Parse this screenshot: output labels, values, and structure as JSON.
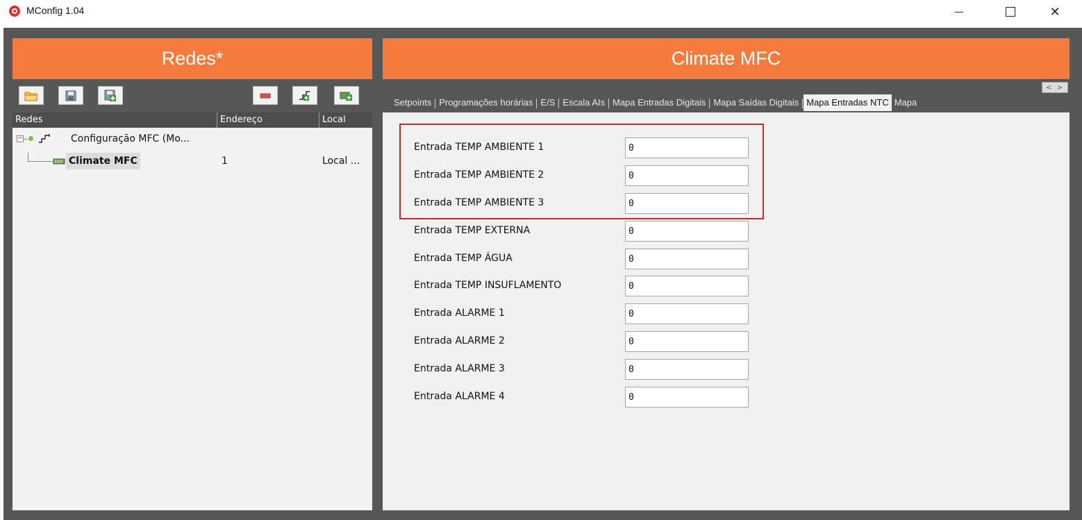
{
  "window": {
    "title": "MConfig 1.04"
  },
  "left": {
    "header": "Redes*",
    "toolbar": [
      "open-folder-icon",
      "save-icon",
      "save-as-icon",
      "remove-icon",
      "add-network-icon",
      "add-device-icon"
    ],
    "columns": [
      "Redes",
      "Endereço",
      "Local"
    ],
    "tree": {
      "root_label": "Configuração MFC (Mo...",
      "child_label": "Climate MFC",
      "child_address": "1",
      "child_local": "Local ..."
    }
  },
  "right": {
    "header": "Climate MFC",
    "tabs": [
      "Setpoints",
      "Programações horárias",
      "E/S",
      "Escala AIs",
      "Mapa Entradas Digitais",
      "Mapa Saídas Digitais",
      "Mapa Entradas NTC",
      "Mapa"
    ],
    "active_tab": "Mapa Entradas NTC",
    "tab_scroll": "< >",
    "fields": [
      {
        "label": "Entrada TEMP AMBIENTE 1",
        "value": "0"
      },
      {
        "label": "Entrada TEMP AMBIENTE 2",
        "value": "0"
      },
      {
        "label": "Entrada TEMP AMBIENTE 3",
        "value": "0"
      },
      {
        "label": "Entrada TEMP EXTERNA",
        "value": "0"
      },
      {
        "label": "Entrada TEMP ÁGUA",
        "value": "0"
      },
      {
        "label": "Entrada TEMP INSUFLAMENTO",
        "value": "0"
      },
      {
        "label": "Entrada ALARME 1",
        "value": "0"
      },
      {
        "label": "Entrada ALARME 2",
        "value": "0"
      },
      {
        "label": "Entrada ALARME 3",
        "value": "0"
      },
      {
        "label": "Entrada ALARME 4",
        "value": "0"
      }
    ]
  },
  "colors": {
    "accent": "#f47b3d",
    "frame": "#575757",
    "highlight": "#c62828"
  }
}
